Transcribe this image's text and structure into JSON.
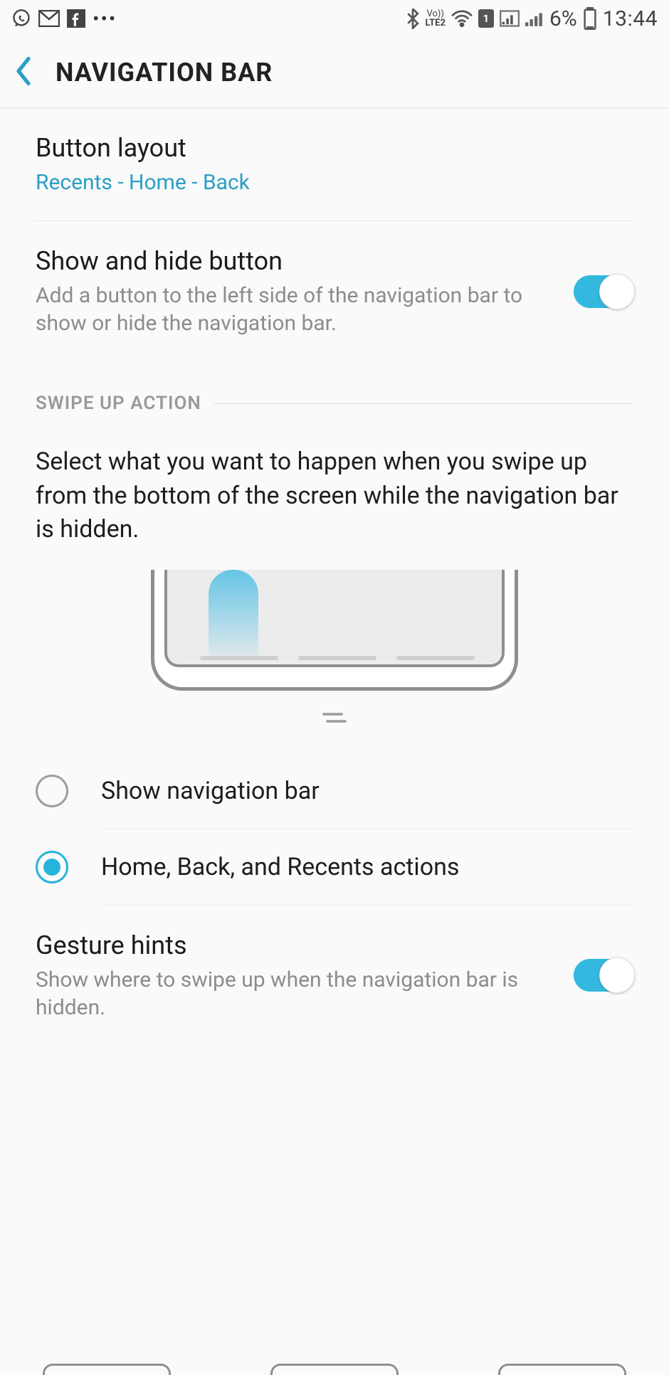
{
  "status": {
    "lte_top": "Vo))",
    "lte_bottom": "LTE2",
    "sim_badge": "1",
    "battery_percent": "6%",
    "time": "13:44"
  },
  "header": {
    "title": "NAVIGATION BAR"
  },
  "button_layout": {
    "title": "Button layout",
    "value": "Recents - Home - Back"
  },
  "show_hide": {
    "title": "Show and hide button",
    "desc": "Add a button to the left side of the navigation bar to show or hide the navigation bar.",
    "enabled": true
  },
  "swipe_section": {
    "header": "SWIPE UP ACTION",
    "desc": "Select what you want to happen when you swipe up from the bottom of the screen while the navigation bar is hidden."
  },
  "radio": {
    "opt1": {
      "label": "Show navigation bar",
      "selected": false
    },
    "opt2": {
      "label": "Home, Back, and Recents actions",
      "selected": true
    }
  },
  "gesture_hints": {
    "title": "Gesture hints",
    "desc": "Show where to swipe up when the navigation bar is hidden.",
    "enabled": true
  }
}
